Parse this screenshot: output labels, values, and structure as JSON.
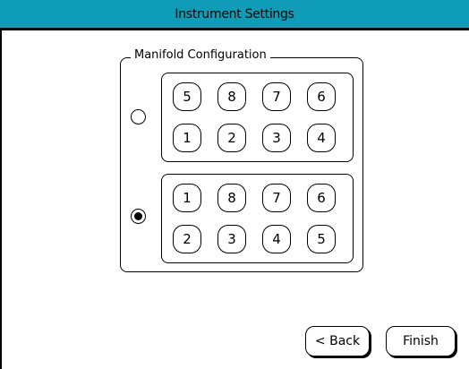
{
  "window": {
    "title": "Instrument Settings"
  },
  "manifold": {
    "group_label": "Manifold Configuration",
    "options": [
      {
        "selected": false,
        "row1": [
          "5",
          "8",
          "7",
          "6"
        ],
        "row2": [
          "1",
          "2",
          "3",
          "4"
        ]
      },
      {
        "selected": true,
        "row1": [
          "1",
          "8",
          "7",
          "6"
        ],
        "row2": [
          "2",
          "3",
          "4",
          "5"
        ]
      }
    ]
  },
  "buttons": {
    "back": "< Back",
    "finish": "Finish"
  },
  "colors": {
    "titlebar": "#0f9cb6"
  }
}
